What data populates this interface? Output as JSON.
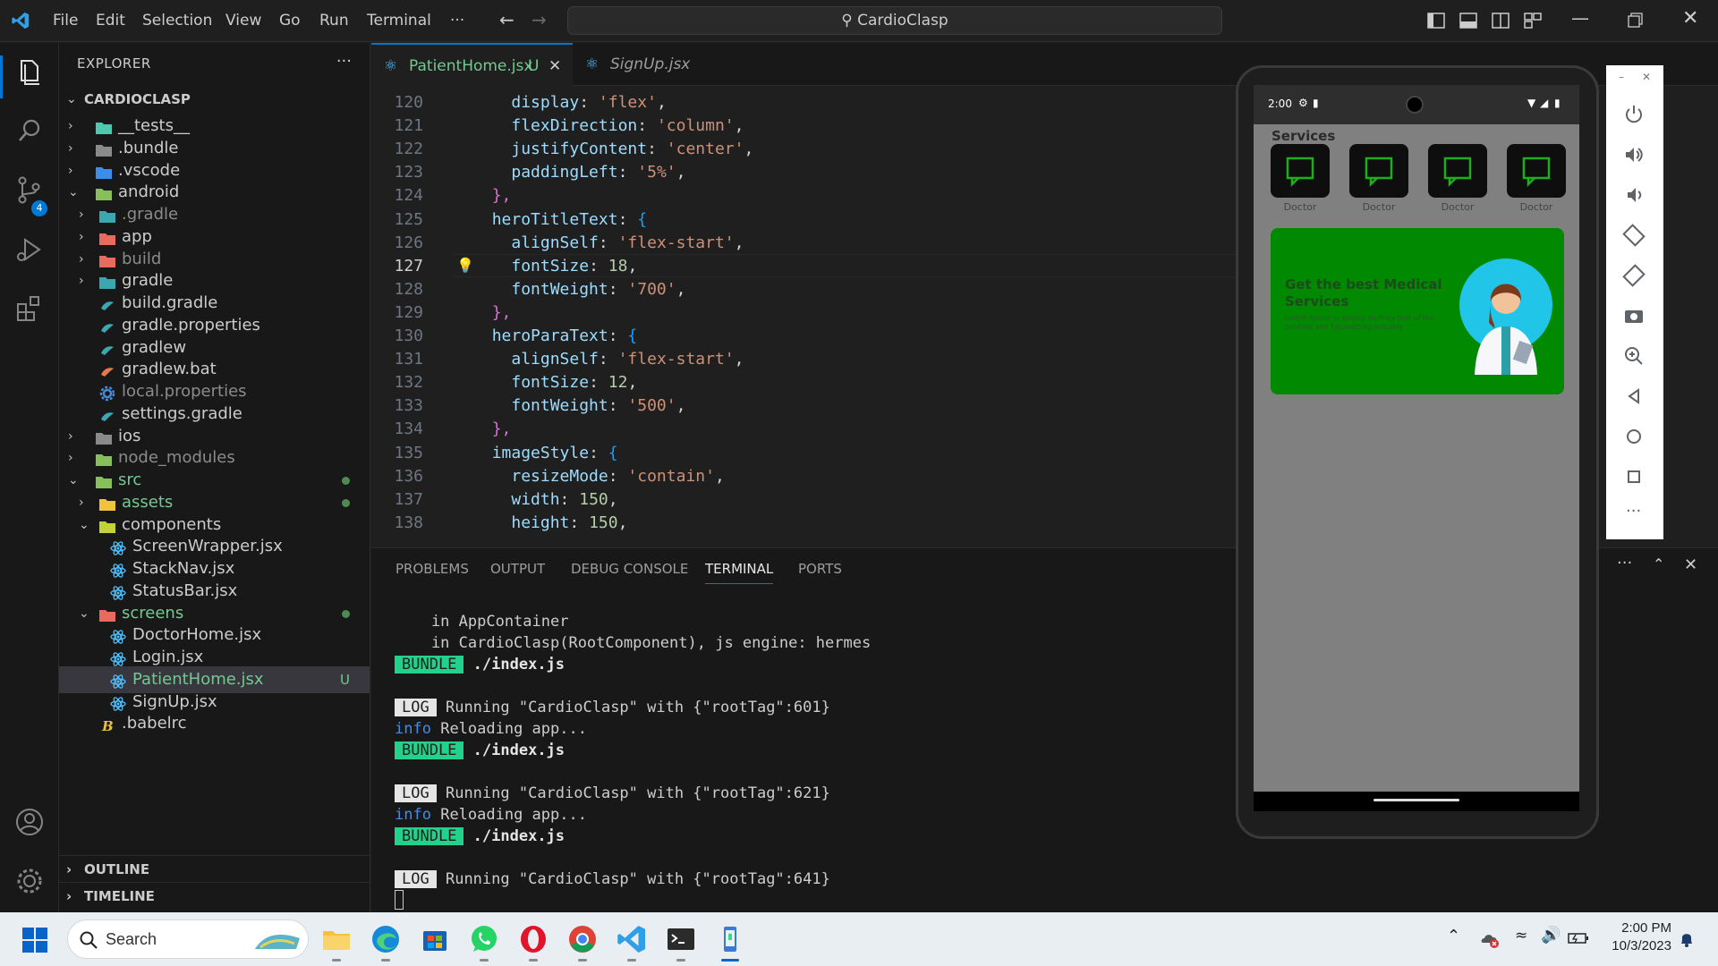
{
  "titlebar": {
    "menu": [
      "File",
      "Edit",
      "Selection",
      "View",
      "Go",
      "Run",
      "Terminal",
      "···"
    ],
    "search": "CardioClasp"
  },
  "activity": {
    "scm_badge": "4"
  },
  "explorer": {
    "title": "EXPLORER",
    "root": "CARDIOCLASP",
    "items": [
      {
        "label": "__tests__"
      },
      {
        "label": ".bundle"
      },
      {
        "label": ".vscode"
      },
      {
        "label": "android"
      },
      {
        "label": ".gradle"
      },
      {
        "label": "app"
      },
      {
        "label": "build"
      },
      {
        "label": "gradle"
      },
      {
        "label": "build.gradle"
      },
      {
        "label": "gradle.properties"
      },
      {
        "label": "gradlew"
      },
      {
        "label": "gradlew.bat"
      },
      {
        "label": "local.properties"
      },
      {
        "label": "settings.gradle"
      },
      {
        "label": "ios"
      },
      {
        "label": "node_modules"
      },
      {
        "label": "src"
      },
      {
        "label": "assets"
      },
      {
        "label": "components"
      },
      {
        "label": "ScreenWrapper.jsx"
      },
      {
        "label": "StackNav.jsx"
      },
      {
        "label": "StatusBar.jsx"
      },
      {
        "label": "screens"
      },
      {
        "label": "DoctorHome.jsx"
      },
      {
        "label": "Login.jsx"
      },
      {
        "label": "PatientHome.jsx",
        "badge": "U"
      },
      {
        "label": "SignUp.jsx"
      },
      {
        "label": ".babelrc"
      }
    ],
    "outline": "OUTLINE",
    "timeline": "TIMELINE"
  },
  "tabs": [
    {
      "label": "PatientHome.jsx",
      "badge": "U"
    },
    {
      "label": "SignUp.jsx"
    }
  ],
  "editor": {
    "lines": [
      {
        "n": "120",
        "indent": "    ",
        "key": "display",
        "val": "'flex'",
        "kind": "s",
        "end": ","
      },
      {
        "n": "121",
        "indent": "    ",
        "key": "flexDirection",
        "val": "'column'",
        "kind": "s",
        "end": ","
      },
      {
        "n": "122",
        "indent": "    ",
        "key": "justifyContent",
        "val": "'center'",
        "kind": "s",
        "end": ","
      },
      {
        "n": "123",
        "indent": "    ",
        "key": "paddingLeft",
        "val": "'5%'",
        "kind": "s",
        "end": ","
      },
      {
        "n": "124",
        "indent": "  ",
        "key": "",
        "val": "},",
        "kind": "p",
        "end": ""
      },
      {
        "n": "125",
        "indent": "  ",
        "key": "heroTitleText",
        "val": "{",
        "kind": "b",
        "end": ""
      },
      {
        "n": "126",
        "indent": "    ",
        "key": "alignSelf",
        "val": "'flex-start'",
        "kind": "s",
        "end": ","
      },
      {
        "n": "127",
        "indent": "    ",
        "key": "fontSize",
        "val": "18",
        "kind": "n",
        "end": ","
      },
      {
        "n": "128",
        "indent": "    ",
        "key": "fontWeight",
        "val": "'700'",
        "kind": "s",
        "end": ","
      },
      {
        "n": "129",
        "indent": "  ",
        "key": "",
        "val": "},",
        "kind": "p",
        "end": ""
      },
      {
        "n": "130",
        "indent": "  ",
        "key": "heroParaText",
        "val": "{",
        "kind": "b",
        "end": ""
      },
      {
        "n": "131",
        "indent": "    ",
        "key": "alignSelf",
        "val": "'flex-start'",
        "kind": "s",
        "end": ","
      },
      {
        "n": "132",
        "indent": "    ",
        "key": "fontSize",
        "val": "12",
        "kind": "n",
        "end": ","
      },
      {
        "n": "133",
        "indent": "    ",
        "key": "fontWeight",
        "val": "'500'",
        "kind": "s",
        "end": ","
      },
      {
        "n": "134",
        "indent": "  ",
        "key": "",
        "val": "},",
        "kind": "p",
        "end": ""
      },
      {
        "n": "135",
        "indent": "  ",
        "key": "imageStyle",
        "val": "{",
        "kind": "b",
        "end": ""
      },
      {
        "n": "136",
        "indent": "    ",
        "key": "resizeMode",
        "val": "'contain'",
        "kind": "s",
        "end": ","
      },
      {
        "n": "137",
        "indent": "    ",
        "key": "width",
        "val": "150",
        "kind": "n",
        "end": ","
      },
      {
        "n": "138",
        "indent": "    ",
        "key": "height",
        "val": "150",
        "kind": "n",
        "end": ","
      }
    ],
    "current_line": "127"
  },
  "panel": {
    "tabs": [
      "PROBLEMS",
      "OUTPUT",
      "DEBUG CONSOLE",
      "TERMINAL",
      "PORTS"
    ],
    "active_tab": "TERMINAL",
    "terminal": {
      "l1": "    in AppContainer",
      "l2": "    in CardioClasp(RootComponent), js engine: hermes",
      "bundle_tag": "BUNDLE",
      "bundle_path": "./index.js",
      "log_tag": "LOG",
      "run1": "Running \"CardioClasp\" with {\"rootTag\":601}",
      "info_tag": "info",
      "reload": "Reloading app...",
      "run2": "Running \"CardioClasp\" with {\"rootTag\":621}",
      "run3": "Running \"CardioClasp\" with {\"rootTag\":641}"
    }
  },
  "phone": {
    "time": "2:00",
    "services_title": "Services",
    "services": [
      "Doctor",
      "Doctor",
      "Doctor",
      "Doctor"
    ],
    "hero_title": "Get the best Medical Services",
    "hero_para": "Lorem Ipsum is simply dummy text of the printing and typesetting industry."
  },
  "taskbar": {
    "search": "Search",
    "time": "2:00 PM",
    "date": "10/3/2023"
  },
  "colors": {
    "accent": "#0078d4",
    "hero_green": "#018901",
    "bundle_green": "#23d18b"
  }
}
